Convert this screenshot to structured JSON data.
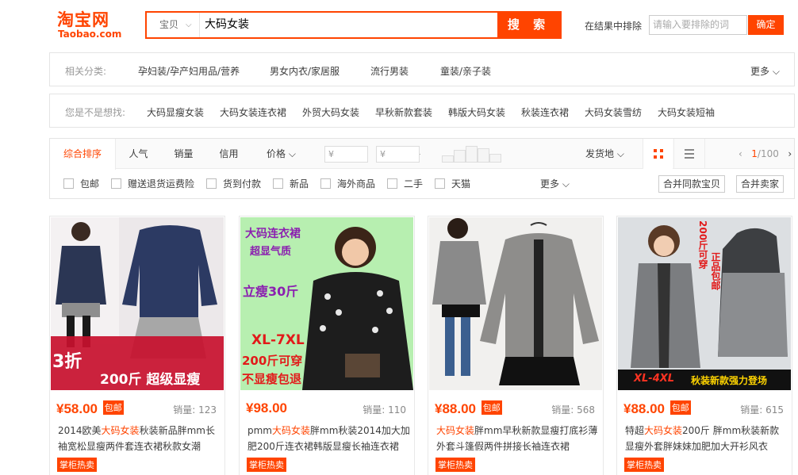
{
  "header": {
    "logo_cn": "淘宝网",
    "logo_en": "Taobao.com",
    "search_type": "宝贝",
    "search_value": "大码女装",
    "search_button": "搜 索",
    "exclude_label": "在结果中排除",
    "exclude_placeholder": "请输入要排除的词",
    "exclude_button": "确定"
  },
  "related": {
    "label": "相关分类:",
    "items": [
      "孕妇装/孕产妇用品/营养",
      "男女内衣/家居服",
      "流行男装",
      "童装/亲子装"
    ],
    "more": "更多"
  },
  "guess": {
    "label": "您是不是想找:",
    "items": [
      "大码显瘦女装",
      "大码女装连衣裙",
      "外贸大码女装",
      "早秋新款套装",
      "韩版大码女装",
      "秋装连衣裙",
      "大码女装雪纺",
      "大码女装短袖"
    ]
  },
  "sort": {
    "tabs": [
      "综合排序",
      "人气",
      "销量",
      "信用",
      "价格"
    ],
    "price_placeholder": "¥",
    "price_dash": "-",
    "ship_from": "发货地",
    "page_current": "1",
    "page_total": "/100"
  },
  "filters": {
    "items": [
      "包邮",
      "赠送退货运费险",
      "货到付款",
      "新品",
      "海外商品",
      "二手",
      "天猫"
    ],
    "more": "更多",
    "merge_same": "合并同款宝贝",
    "merge_seller": "合并卖家"
  },
  "products": [
    {
      "price": "¥58.00",
      "baoyou": "包邮",
      "sales_label": "销量:",
      "sales": "123",
      "title_pre": "2014欧美",
      "title_hl": "大码女装",
      "title_post": "秋装新品胖mm长袖宽松显瘦两件套连衣裙秋款女潮",
      "tag": "掌柜热卖",
      "overlay": [
        "3折",
        "200斤 超级显瘦"
      ],
      "bg": "#e9e4e6"
    },
    {
      "price": "¥98.00",
      "baoyou": "",
      "sales_label": "销量:",
      "sales": "110",
      "title_pre": "pmm",
      "title_hl": "大码女装",
      "title_post": "胖mm秋装2014加大加肥200斤连衣裙韩版显瘦长袖连衣裙",
      "tag": "掌柜热卖",
      "overlay": [
        "大码连衣裙",
        "超显气质",
        "立瘦30斤",
        "XL-7XL",
        "200斤可穿",
        "不显瘦包退"
      ],
      "bg": "#b8f0b0"
    },
    {
      "price": "¥88.00",
      "baoyou": "包邮",
      "sales_label": "销量:",
      "sales": "568",
      "title_pre": "",
      "title_hl": "大码女装",
      "title_post": "胖mm早秋新款显瘦打底衫薄外套斗篷假两件拼接长袖连衣裙",
      "tag": "掌柜热卖",
      "overlay": [],
      "bg": "#f0efed"
    },
    {
      "price": "¥88.00",
      "baoyou": "包邮",
      "sales_label": "销量:",
      "sales": "615",
      "title_pre": "特超",
      "title_hl": "大码女装",
      "title_post": "200斤 胖mm秋装新款显瘦外套胖妹妹加肥加大开衫风衣",
      "tag": "掌柜热卖",
      "overlay": [
        "200斤可穿",
        "正品包邮",
        "XL-4XL",
        "秋装新款强力登场"
      ],
      "bg": "#d9dcdf"
    }
  ]
}
